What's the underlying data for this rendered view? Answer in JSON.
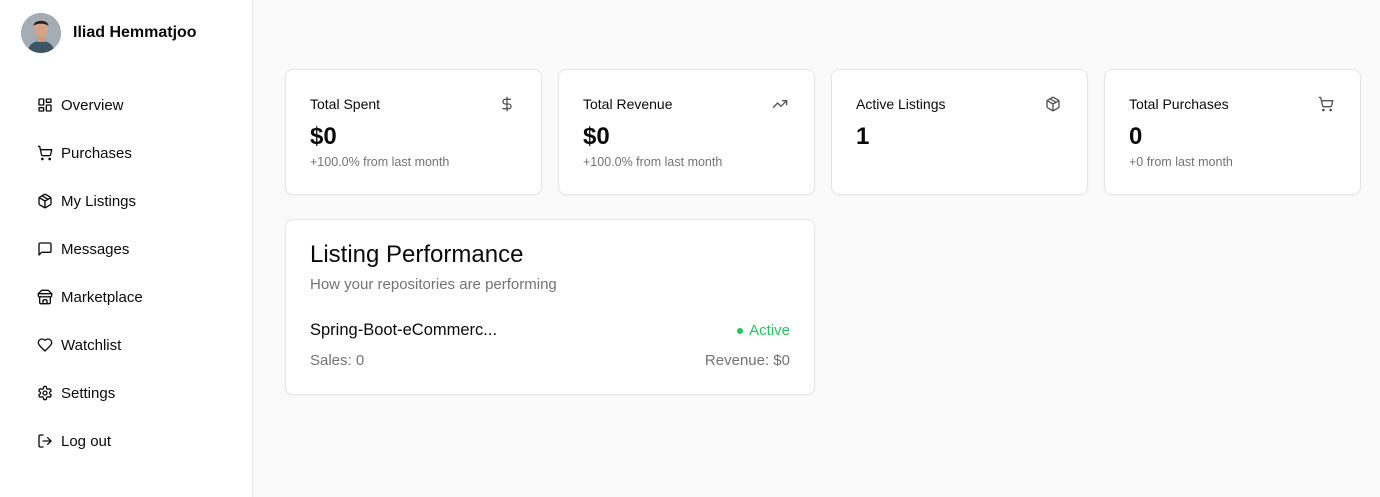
{
  "user": {
    "name": "Iliad Hemmatjoo"
  },
  "nav": [
    {
      "label": "Overview",
      "icon": "layout-dashboard-icon"
    },
    {
      "label": "Purchases",
      "icon": "shopping-cart-icon"
    },
    {
      "label": "My Listings",
      "icon": "package-icon"
    },
    {
      "label": "Messages",
      "icon": "message-square-icon"
    },
    {
      "label": "Marketplace",
      "icon": "store-icon"
    },
    {
      "label": "Watchlist",
      "icon": "heart-icon"
    },
    {
      "label": "Settings",
      "icon": "settings-icon"
    },
    {
      "label": "Log out",
      "icon": "log-out-icon"
    }
  ],
  "stats": [
    {
      "title": "Total Spent",
      "value": "$0",
      "sub": "+100.0% from last month",
      "icon": "dollar-sign-icon"
    },
    {
      "title": "Total Revenue",
      "value": "$0",
      "sub": "+100.0% from last month",
      "icon": "trending-up-icon"
    },
    {
      "title": "Active Listings",
      "value": "1",
      "sub": "",
      "icon": "package-icon"
    },
    {
      "title": "Total Purchases",
      "value": "0",
      "sub": "+0 from last month",
      "icon": "shopping-cart-icon"
    }
  ],
  "performance": {
    "title": "Listing Performance",
    "description": "How your repositories are performing",
    "listings": [
      {
        "name": "Spring-Boot-eCommerc...",
        "status": "Active",
        "sales": "Sales: 0",
        "revenue": "Revenue: $0"
      }
    ]
  },
  "colors": {
    "active": "#22c55e",
    "muted": "#737373",
    "border": "#e5e5e5"
  }
}
